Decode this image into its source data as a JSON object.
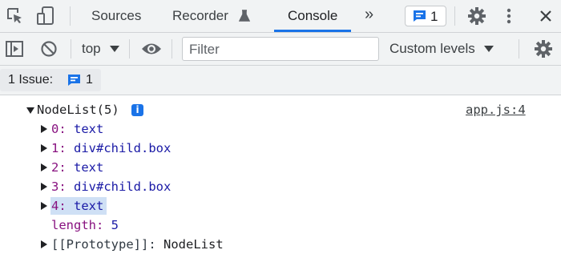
{
  "tabs": {
    "sources": "Sources",
    "recorder": "Recorder",
    "console": "Console",
    "more": "»",
    "issues_count": "1"
  },
  "toolbar": {
    "context": "top",
    "filter_placeholder": "Filter",
    "levels": "Custom levels"
  },
  "issues_bar": {
    "label": "1 Issue:",
    "count": "1"
  },
  "console": {
    "source_link": "app.js:4",
    "header": "NodeList(5)",
    "items": [
      {
        "key": "0",
        "value": "text"
      },
      {
        "key": "1",
        "value": "div#child.box"
      },
      {
        "key": "2",
        "value": "text"
      },
      {
        "key": "3",
        "value": "div#child.box"
      },
      {
        "key": "4",
        "value": "text"
      }
    ],
    "length_label": "length",
    "length_value": "5",
    "prototype_label": "[[Prototype]]",
    "prototype_value": "NodeList"
  },
  "colors": {
    "accent": "#1a73e8",
    "key": "#881280",
    "value": "#1a1aa6",
    "selected_highlight": "#cfe0f5"
  }
}
